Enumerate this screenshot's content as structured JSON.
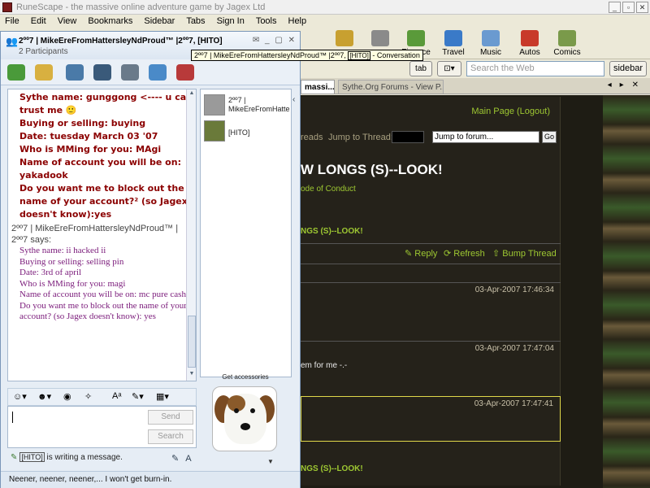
{
  "browser": {
    "title": "RuneScape - the massive online adventure game by Jagex Ltd",
    "menu": [
      "File",
      "Edit",
      "View",
      "Bookmarks",
      "Sidebar",
      "Tabs",
      "Sign In",
      "Tools",
      "Help"
    ],
    "toolbar": [
      {
        "label": "",
        "icon": "shopping-bag-icon",
        "color": "#c8a030"
      },
      {
        "label": "",
        "icon": "newspaper-icon",
        "color": "#8a8a8a"
      },
      {
        "label": "Finance",
        "icon": "finance-icon",
        "color": "#5a9a3a"
      },
      {
        "label": "Travel",
        "icon": "travel-icon",
        "color": "#3a7ac8"
      },
      {
        "label": "Music",
        "icon": "music-icon",
        "color": "#6a9ad0"
      },
      {
        "label": "Autos",
        "icon": "car-icon",
        "color": "#c83a2a"
      },
      {
        "label": "Comics",
        "icon": "comics-icon",
        "color": "#7a9a4a"
      }
    ],
    "tab_button": "tab",
    "search_placeholder": "Search the Web",
    "sidebar_button": "sidebar",
    "tabs": {
      "active": "massi...",
      "other": "Sythe.Org Forums - View P..."
    }
  },
  "forum": {
    "main_page": "Main Page (Logout)",
    "threads": "reads",
    "jump_label": "Jump to Thread:",
    "jump_forum": "Jump to forum...",
    "go": "Go",
    "thread_title": "W LONGS (S)--LOOK!",
    "code_of_conduct": "ode of Conduct",
    "thread_sub": "NGS (S)--LOOK!",
    "actions": [
      "Reply",
      "Refresh",
      "Bump Thread"
    ],
    "posts": [
      {
        "date": "03-Apr-2007 17:46:34",
        "body": ""
      },
      {
        "date": "03-Apr-2007 17:47:04",
        "body": "em for me -.-"
      },
      {
        "date": "03-Apr-2007 17:47:41",
        "body": ""
      }
    ],
    "bottom_sub": "NGS (S)--LOOK!"
  },
  "im": {
    "title": "2ºº7 | MikeEreFromHattersleyNdProud™ |2ºº7, [HITO]",
    "participants_count": "2 Participants",
    "tooltip": {
      "left": "2ºº7 | MikeEreFromHattersleyNdProud™ |2ºº7,",
      "hito": "[HITO]",
      "right": " - Conversation"
    },
    "red_lines": [
      "Sythe name: gunggong <---- u can trust me 🙂",
      "Buying or selling: buying",
      "Date:  tuesday  March 03 '07",
      "Who is MMing for you: MAgi",
      "Name of account you will be on: yakadook",
      "Do you want me to block out the name of your account?² (so Jagex doesn't know):yes"
    ],
    "sender": "2ºº7 | MikeEreFromHattersleyNdProud™ | 2ºº7 says:",
    "purple_lines": [
      "Sythe name: ii hacked ii",
      "Buying or selling: selling pin",
      "Date: 3rd of april",
      "Who is MMing for you: magi",
      "Name of account you will be on: mc pure cash",
      "Do you want me to block out the name of your account? (so Jagex doesn't know): yes"
    ],
    "participants": [
      {
        "name": "2ºº7 | MikeEreFromHatte"
      },
      {
        "name": "[HITO]"
      }
    ],
    "get_accessories": "Get accessories",
    "send": "Send",
    "search": "Search",
    "typing_name": "[HITO]",
    "typing_text": " is writing a message.",
    "status": "Neener, neener, neener,... I won't get burn-in."
  }
}
